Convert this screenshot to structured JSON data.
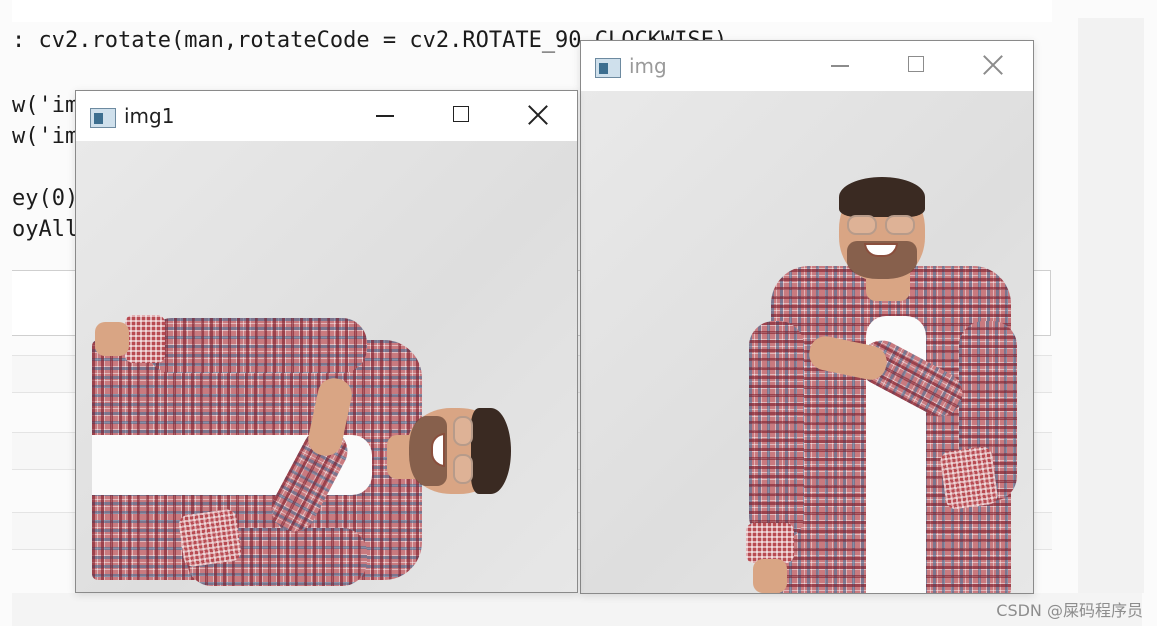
{
  "editor": {
    "code_lines": [
      {
        "prefix": ": ",
        "text": "cv2.rotate(man,rotateCode = cv2.ROTATE_90_CLOCKWISE)"
      },
      {
        "prefix": "w('im",
        "text": ""
      },
      {
        "prefix": "w('im",
        "text": ""
      },
      {
        "prefix": "ey(0)",
        "text": ""
      },
      {
        "prefix": "oyAll",
        "text": ""
      }
    ]
  },
  "windows": [
    {
      "title": "img1",
      "state": "active",
      "image": "man-rotated-90-clockwise"
    },
    {
      "title": "img",
      "state": "inactive",
      "image": "man-original"
    }
  ],
  "watermark": "CSDN @屎码程序员",
  "colors": {
    "window_titlebar": "#ffffff",
    "image_background": "#e4e4e4",
    "shirt_plaid": "#c97a7f",
    "code_keyword": "#0b36b5"
  },
  "icons": [
    "app-window-icon",
    "minimize-icon",
    "maximize-icon",
    "close-icon"
  ]
}
